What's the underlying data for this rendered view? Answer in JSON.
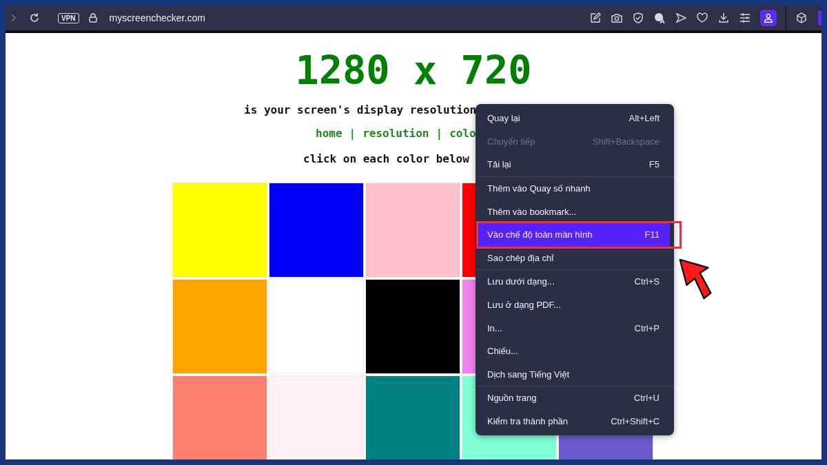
{
  "toolbar": {
    "vpn_label": "VPN",
    "url": "myscreenchecker.com"
  },
  "page": {
    "resolution": "1280 x 720",
    "subtitle": "is your screen's display resolution",
    "nav": [
      "home",
      "resolution",
      "colo"
    ],
    "nav_separator": "|",
    "instruction": "click on each color below",
    "swatch_rows": [
      [
        {
          "color": "#ffff00"
        },
        {
          "color": "#0000ff"
        },
        {
          "color": "#ffc0cb"
        },
        {
          "color": "#ff0000"
        }
      ],
      [
        {
          "color": "#ffa500"
        },
        {
          "color": "#ffffff"
        },
        {
          "color": "#000000"
        },
        {
          "color": "#ee82ee"
        }
      ],
      [
        {
          "color": "#fa8072"
        },
        {
          "color": "#fff0f5"
        },
        {
          "color": "#008080"
        },
        {
          "color": "#7fffd4"
        },
        {
          "color": "#6a5acd"
        }
      ]
    ]
  },
  "context_menu": {
    "sections": [
      [
        {
          "label": "Quay lại",
          "shortcut": "Alt+Left",
          "disabled": false,
          "selected": false
        },
        {
          "label": "Chuyển tiếp",
          "shortcut": "Shift+Backspace",
          "disabled": true,
          "selected": false
        },
        {
          "label": "Tải lại",
          "shortcut": "F5",
          "disabled": false,
          "selected": false
        }
      ],
      [
        {
          "label": "Thêm vào Quay số nhanh",
          "disabled": false,
          "selected": false
        },
        {
          "label": "Thêm vào bookmark...",
          "disabled": false,
          "selected": false
        },
        {
          "label": "Vào chế độ toàn màn hình",
          "shortcut": "F11",
          "disabled": false,
          "selected": true
        },
        {
          "label": "Sao chép địa chỉ",
          "disabled": false,
          "selected": false
        }
      ],
      [
        {
          "label": "Lưu dưới dạng...",
          "shortcut": "Ctrl+S",
          "disabled": false,
          "selected": false
        },
        {
          "label": "Lưu ở dạng PDF...",
          "disabled": false,
          "selected": false
        },
        {
          "label": "In...",
          "shortcut": "Ctrl+P",
          "disabled": false,
          "selected": false
        },
        {
          "label": "Chiếu...",
          "disabled": false,
          "selected": false
        },
        {
          "label": "Dịch sang Tiếng Việt",
          "disabled": false,
          "selected": false
        }
      ],
      [
        {
          "label": "Nguồn trang",
          "shortcut": "Ctrl+U",
          "disabled": false,
          "selected": false
        },
        {
          "label": "Kiểm tra thành phần",
          "shortcut": "Ctrl+Shift+C",
          "disabled": false,
          "selected": false
        }
      ]
    ]
  }
}
